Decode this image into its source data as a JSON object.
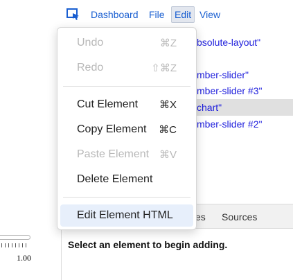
{
  "menubar": {
    "select_tool_icon": "select-cursor-icon",
    "items": [
      {
        "label": "Dashboard"
      },
      {
        "label": "File"
      },
      {
        "label": "Edit"
      },
      {
        "label": "View"
      }
    ]
  },
  "tree": {
    "rows": [
      {
        "text": "bsolute-layout\"",
        "selected": false
      },
      {
        "text": "mber-slider\"",
        "selected": false
      },
      {
        "text": "mber-slider #3\"",
        "selected": false
      },
      {
        "text": "chart\"",
        "selected": true
      },
      {
        "text": "mber-slider #2\"",
        "selected": false
      }
    ]
  },
  "canvas": {
    "slider_value": "1.00"
  },
  "tabs": {
    "partial": "es",
    "sources": "Sources"
  },
  "panel": {
    "empty_message": "Select an element to begin adding."
  },
  "edit_menu": {
    "items": [
      {
        "label": "Undo",
        "shortcut": "⌘Z",
        "disabled": true
      },
      {
        "label": "Redo",
        "shortcut": "⇧⌘Z",
        "disabled": true
      },
      {
        "label": "Cut Element",
        "shortcut": "⌘X",
        "disabled": false
      },
      {
        "label": "Copy Element",
        "shortcut": "⌘C",
        "disabled": false
      },
      {
        "label": "Paste Element",
        "shortcut": "⌘V",
        "disabled": true
      },
      {
        "label": "Delete Element",
        "shortcut": "",
        "disabled": false
      },
      {
        "label": "Edit Element HTML",
        "shortcut": "",
        "disabled": false,
        "highlighted": true
      }
    ]
  },
  "colors": {
    "link": "#1a5fd1",
    "tree_text": "#1d1ddc",
    "highlight": "#e7effb"
  }
}
